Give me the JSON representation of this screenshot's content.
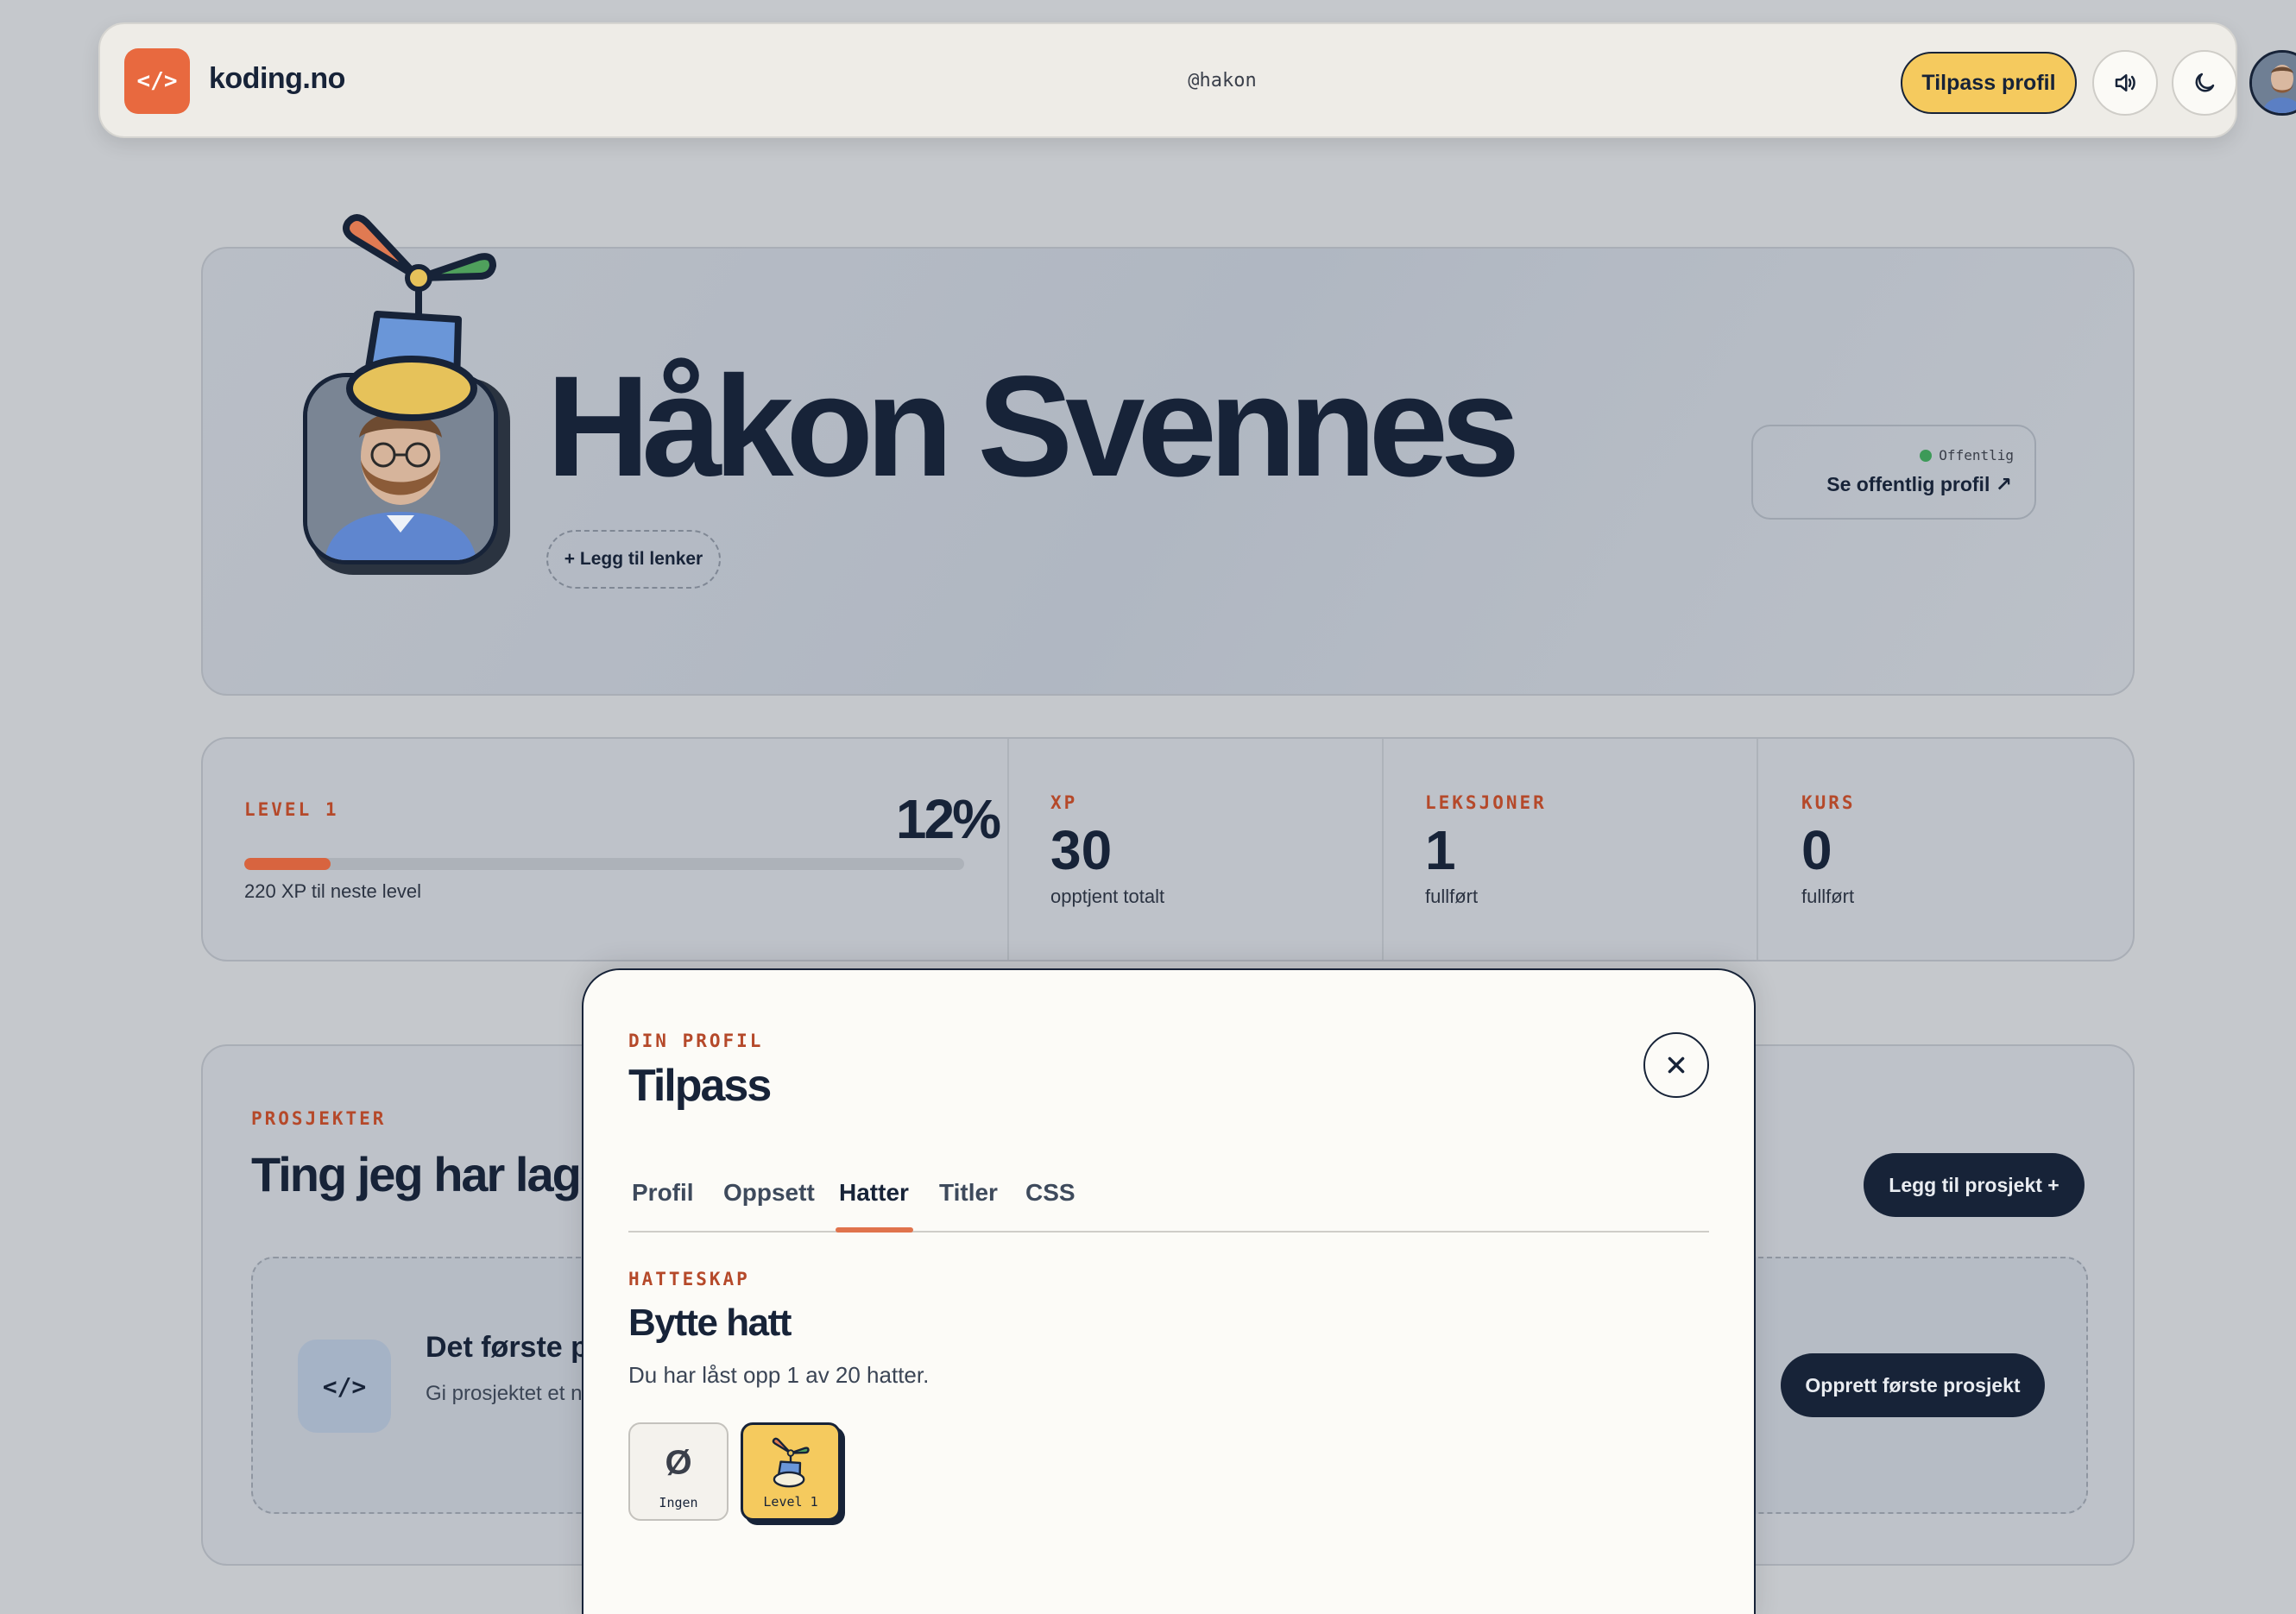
{
  "nav": {
    "logo_glyph": "</>",
    "site_name": "koding.no",
    "handle": "@hakon",
    "customize_label": "Tilpass profil",
    "sound_icon": "speaker-icon",
    "theme_icon": "moon-icon",
    "avatar_icon": "user-avatar"
  },
  "hero": {
    "name": "Håkon Svennes",
    "add_links_label": "+ Legg til lenker",
    "visibility_label": "Offentlig",
    "visibility_color": "#3d9a58",
    "public_link_label": "Se offentlig profil ↗",
    "hat_icon": "propeller-hat-icon"
  },
  "stats": {
    "level_label": "LEVEL 1",
    "level_percent_label": "12%",
    "level_progress": 0.12,
    "level_sub": "220 XP til neste level",
    "xp_label": "XP",
    "xp_value": "30",
    "xp_sub": "opptjent totalt",
    "lessons_label": "LEKSJONER",
    "lessons_value": "1",
    "lessons_sub": "fullført",
    "courses_label": "KURS",
    "courses_value": "0",
    "courses_sub": "fullført"
  },
  "projects": {
    "eyebrow": "PROSJEKTER",
    "title": "Ting jeg har lage",
    "add_label": "Legg til prosjekt +",
    "empty_glyph": "</>",
    "empty_title": "Det første p",
    "empty_desc": "Gi prosjektet et n har noe nytt å fe",
    "create_label": "Opprett første prosjekt"
  },
  "modal": {
    "eyebrow": "DIN PROFIL",
    "title": "Tilpass",
    "close_icon": "close-icon",
    "tabs": [
      "Profil",
      "Oppsett",
      "Hatter",
      "Titler",
      "CSS"
    ],
    "active_tab": "Hatter",
    "section_eyebrow": "HATTESKAP",
    "section_title": "Bytte hatt",
    "section_desc": "Du har låst opp 1 av 20 hatter.",
    "hats": [
      {
        "glyph": "Ø",
        "label": "Ingen"
      },
      {
        "label": "Level 1",
        "icon": "propeller-hat-icon"
      }
    ]
  },
  "colors": {
    "accent": "#e8693f",
    "primary_button": "#f5ca5e",
    "dark": "#172338",
    "eyebrow": "#b5492a"
  }
}
